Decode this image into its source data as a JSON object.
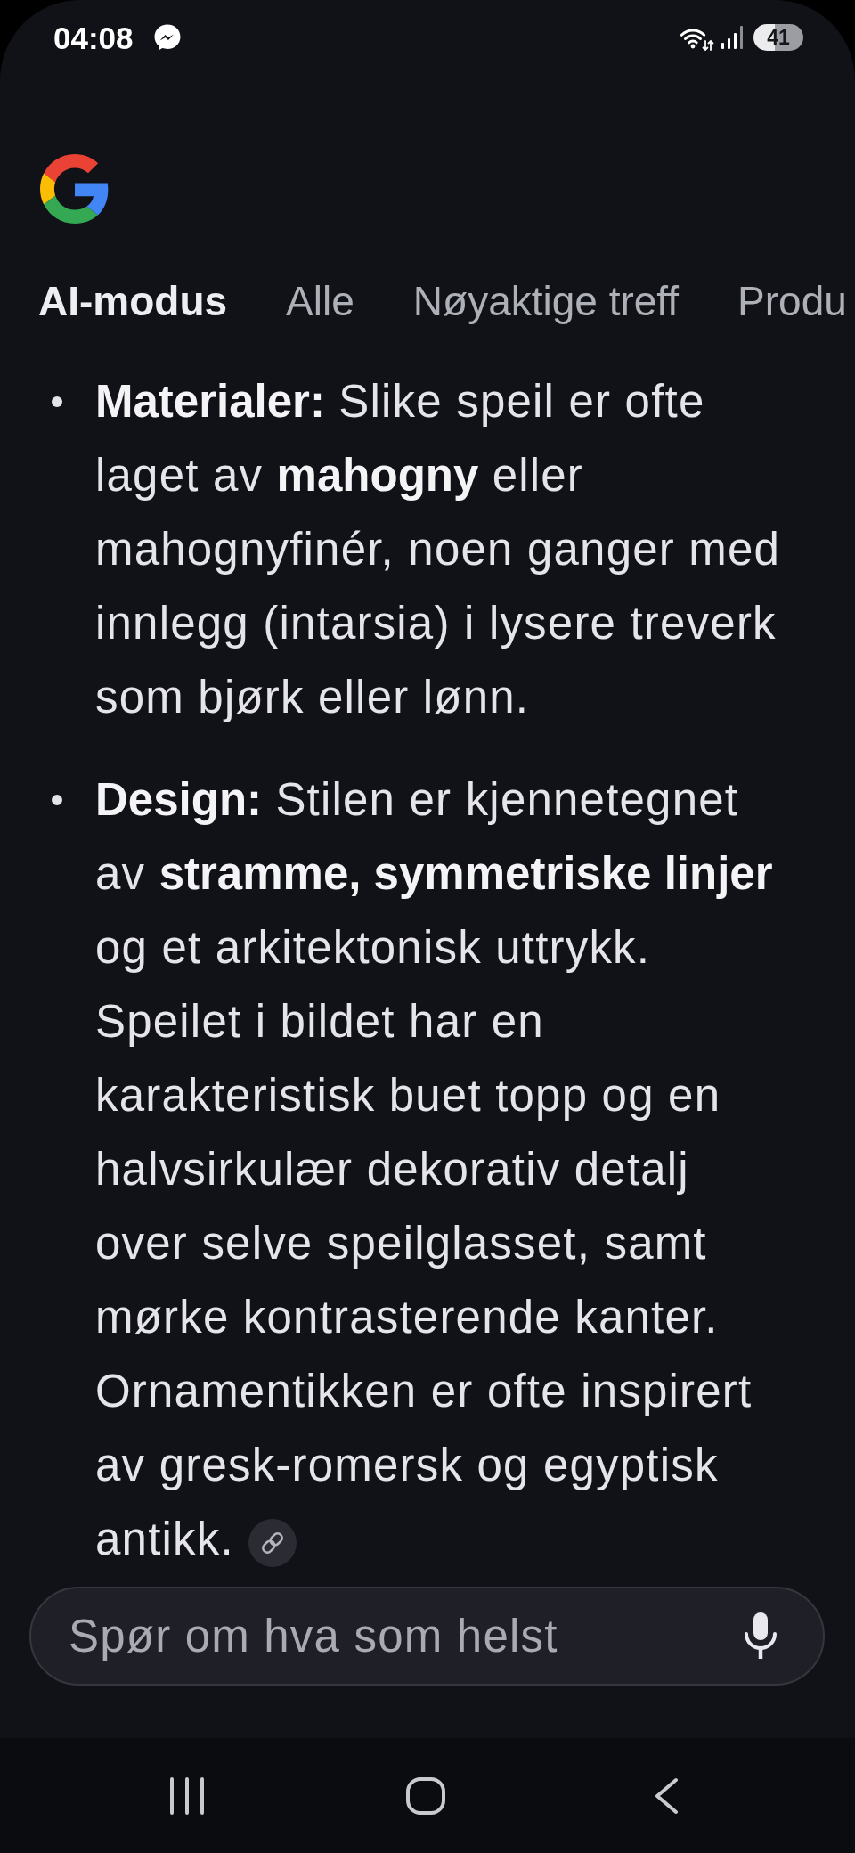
{
  "status_bar": {
    "time": "04:08",
    "battery": "41"
  },
  "tabs": [
    {
      "label": "AI-modus",
      "selected": true
    },
    {
      "label": "Alle",
      "selected": false
    },
    {
      "label": "Nøyaktige treff",
      "selected": false
    },
    {
      "label": "Produ",
      "selected": false
    }
  ],
  "answer": {
    "bullets": [
      {
        "text": "**Materialer:** Slike speil er ofte laget av **mahogny** eller mahognyfinér, noen ganger med innlegg (intarsia) i lysere treverk som bjørk eller lønn.",
        "source_link": false
      },
      {
        "text": "**Design:** Stilen er kjennetegnet av **stramme, symmetriske linjer** og et arkitektonisk uttrykk. Speilet i bildet har en karakteristisk buet topp og en halvsirkulær dekorativ detalj over selve speilglasset, samt mørke kontrasterende kanter. Ornamentikken er ofte inspirert av gresk-romersk og egyptisk antikk.",
        "source_link": true
      }
    ]
  },
  "search": {
    "placeholder": "Spør om hva som helst"
  }
}
